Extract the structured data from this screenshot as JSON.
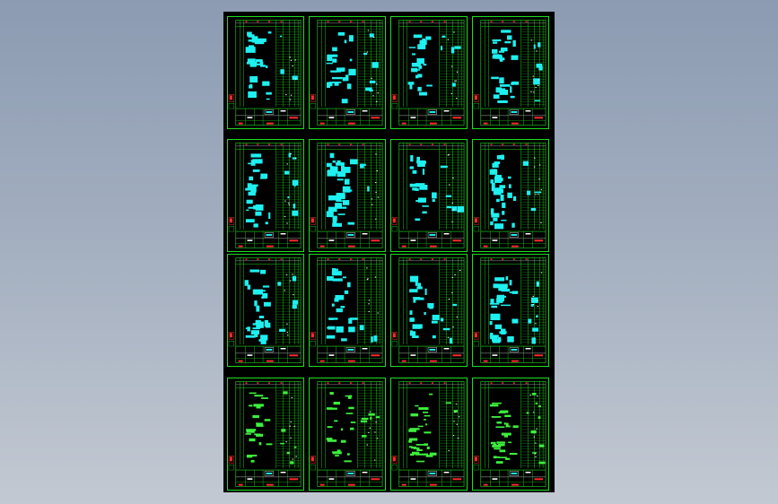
{
  "viewport": {
    "background": "gradient-gray-blue"
  },
  "drawing": {
    "description_visible_text": [],
    "colors": {
      "border": "#1fdc1f",
      "grid_line": "#1fdc1f",
      "red": "#ff2a2a",
      "cyan": "#1ef0f0",
      "white": "#ffffff",
      "green_text": "#3cf03c",
      "canvas": "#000000"
    },
    "sheet_rows": 4,
    "sheet_cols": 4,
    "sheets": [
      {
        "fill": "cyan"
      },
      {
        "fill": "cyan"
      },
      {
        "fill": "cyan"
      },
      {
        "fill": "cyan"
      },
      {
        "fill": "cyan"
      },
      {
        "fill": "cyan"
      },
      {
        "fill": "cyan"
      },
      {
        "fill": "cyan"
      },
      {
        "fill": "cyan"
      },
      {
        "fill": "cyan"
      },
      {
        "fill": "cyan"
      },
      {
        "fill": "cyan"
      },
      {
        "fill": "green"
      },
      {
        "fill": "green"
      },
      {
        "fill": "green"
      },
      {
        "fill": "green"
      }
    ]
  }
}
